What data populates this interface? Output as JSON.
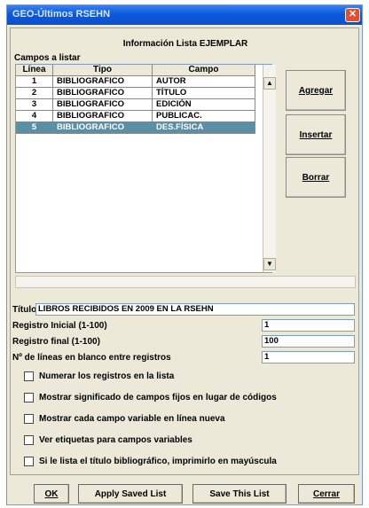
{
  "window": {
    "title": "GEO-Últimos RSEHN",
    "close": "✕"
  },
  "panel": {
    "title": "Información Lista EJEMPLAR",
    "campos_label": "Campos a listar"
  },
  "table": {
    "headers": [
      "Línea",
      "Tipo",
      "Campo"
    ],
    "rows": [
      {
        "linea": "1",
        "tipo": "BIBLIOGRAFICO",
        "campo": "AUTOR",
        "selected": false
      },
      {
        "linea": "2",
        "tipo": "BIBLIOGRAFICO",
        "campo": "TÍTULO",
        "selected": false
      },
      {
        "linea": "3",
        "tipo": "BIBLIOGRAFICO",
        "campo": "EDICIÓN",
        "selected": false
      },
      {
        "linea": "4",
        "tipo": "BIBLIOGRAFICO",
        "campo": "PUBLICAC.",
        "selected": false
      },
      {
        "linea": "5",
        "tipo": "BIBLIOGRAFICO",
        "campo": "DES.FÍSICA",
        "selected": true
      }
    ]
  },
  "side_buttons": {
    "agregar": "Agregar",
    "insertar": "Insertar",
    "borrar": "Borrar"
  },
  "fields": {
    "titulo_label": "Título",
    "titulo_value": "LIBROS RECIBIDOS EN 2009 EN LA RSEHN",
    "registro_inicial_label": "Registro Inicial (1-100)",
    "registro_inicial_value": "1",
    "registro_final_label": "Registro final (1-100)",
    "registro_final_value": "100",
    "lineas_blanco_label": "Nº de líneas en blanco entre registros",
    "lineas_blanco_value": "1"
  },
  "checkboxes": [
    {
      "label": "Numerar los registros en la lista",
      "checked": false
    },
    {
      "label": "Mostrar significado de campos fijos en lugar de códigos",
      "checked": false
    },
    {
      "label": "Mostrar cada campo variable en línea nueva",
      "checked": false
    },
    {
      "label": "Ver etiquetas para campos variables",
      "checked": false
    },
    {
      "label": "Si le lista el título bibliográfico, imprimirlo en mayúscula",
      "checked": false
    }
  ],
  "bottom_buttons": {
    "ok": "OK",
    "apply": "Apply Saved List",
    "save": "Save This List",
    "cerrar": "Cerrar"
  }
}
